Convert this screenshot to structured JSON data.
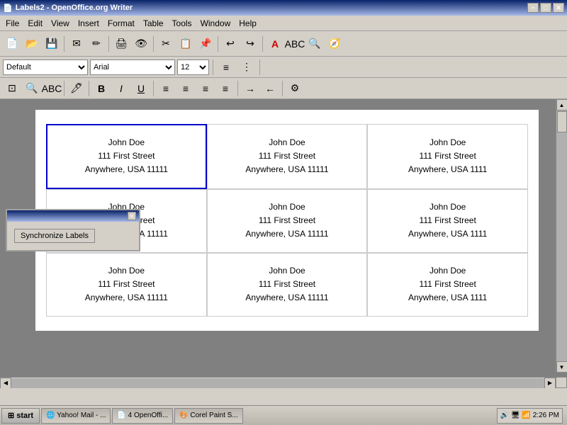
{
  "titleBar": {
    "title": "Labels2 - OpenOffice.org Writer",
    "minBtn": "−",
    "maxBtn": "□",
    "closeBtn": "✕"
  },
  "menuBar": {
    "items": [
      "File",
      "Edit",
      "View",
      "Insert",
      "Format",
      "Table",
      "Tools",
      "Window",
      "Help"
    ]
  },
  "formatToolbar": {
    "style": "Default",
    "font": "Arial",
    "size": "12"
  },
  "floatingPanel": {
    "title": "",
    "syncBtn": "Synchronize Labels"
  },
  "labels": {
    "address": {
      "name": "John Doe",
      "street": "111 First Street",
      "city": "Anywhere, USA 11111"
    }
  },
  "taskbar": {
    "start": "start",
    "items": [
      "Yahoo! Mail - ...",
      "4 OpenOffi...",
      "Corel Paint S..."
    ],
    "time": "2:26 PM"
  }
}
